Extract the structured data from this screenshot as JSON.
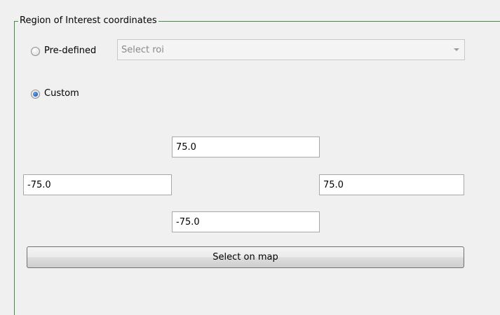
{
  "group": {
    "title": "Region of Interest coordinates"
  },
  "predefined": {
    "label": "Pre-defined",
    "checked": false,
    "combo_value": "Select roi",
    "combo_icon": "chevron-down-icon"
  },
  "custom": {
    "label": "Custom",
    "checked": true
  },
  "coordinates": {
    "north": "75.0",
    "west": "-75.0",
    "east": "75.0",
    "south": "-75.0"
  },
  "map_button": {
    "label": "Select on map"
  }
}
